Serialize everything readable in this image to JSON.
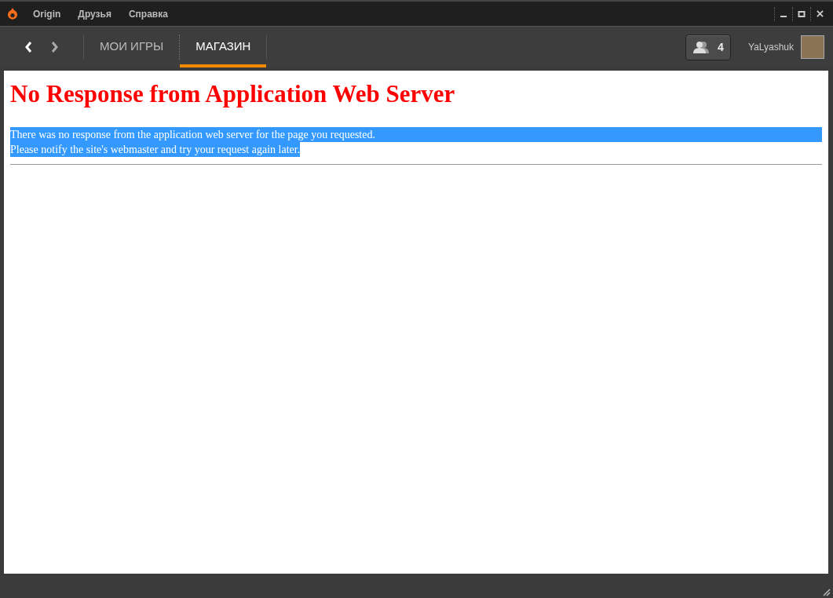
{
  "menu_bar": {
    "items": [
      "Origin",
      "Друзья",
      "Справка"
    ]
  },
  "nav": {
    "tabs": [
      {
        "label": "МОИ ИГРЫ",
        "selected": false
      },
      {
        "label": "МАГАЗИН",
        "selected": true
      }
    ],
    "friends_count": "4",
    "username": "YaLyashuk"
  },
  "page": {
    "heading": "No Response from Application Web Server",
    "message_highlighted": true,
    "lines": [
      "There was no response from the application web server for the page you requested.",
      "Please notify the site's webmaster and try your request again later."
    ]
  }
}
